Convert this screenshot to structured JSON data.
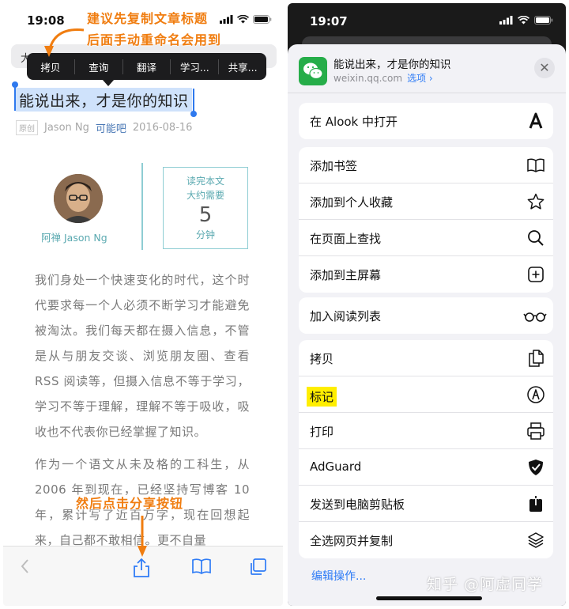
{
  "left": {
    "time": "19:08",
    "address_prefix": "大",
    "annotation_top_line1": "建议先复制文章标题",
    "annotation_top_line2": "后面手动重命名会用到",
    "annotation_bottom": "然后点击分享按钮",
    "edit_menu": [
      "拷贝",
      "查询",
      "翻译",
      "学习...",
      "共享..."
    ],
    "article": {
      "title": "能说出来，才是你的知识",
      "original_badge": "原创",
      "author_name": "Jason Ng",
      "author_link": "可能吧",
      "date": "2016-08-16",
      "author_caption": "阿禅 Jason Ng",
      "read_line1": "读完本文",
      "read_line2": "大约需要",
      "read_minutes": "5",
      "read_unit": "分钟",
      "paragraph1": "我们身处一个快速变化的时代，这个时代要求每一个人必须不断学习才能避免被淘汰。我们每天都在摄入信息，不管是从与朋友交谈、浏览朋友圈、查看 RSS 阅读等，但摄入信息不等于学习，学习不等于理解，理解不等于吸收，吸收也不代表你已经掌握了知识。",
      "paragraph2": "作为一个语文从未及格的工科生，从 2006 年到现在，已经坚持写博客 10 年，累计写了近百万字，现在回想起来，自己都不敢相信。更不自量"
    },
    "toolbar_icons": [
      "chevron-left-icon",
      "share-icon",
      "book-icon",
      "tabs-icon"
    ]
  },
  "right": {
    "time": "19:07",
    "sheet_title": "能说出来，才是你的知识",
    "sheet_domain": "weixin.qq.com",
    "sheet_options": "选项 ›",
    "close_symbol": "✕",
    "groups": [
      [
        {
          "label": "在 Alook 中打开",
          "icon": "alook-icon"
        }
      ],
      [
        {
          "label": "添加书签",
          "icon": "book-icon"
        },
        {
          "label": "添加到个人收藏",
          "icon": "star-icon"
        },
        {
          "label": "在页面上查找",
          "icon": "search-icon"
        },
        {
          "label": "添加到主屏幕",
          "icon": "plus-square-icon"
        }
      ],
      [
        {
          "label": "加入阅读列表",
          "icon": "glasses-icon"
        }
      ],
      [
        {
          "label": "拷贝",
          "icon": "copy-icon"
        },
        {
          "label": "标记",
          "icon": "markup-icon"
        },
        {
          "label": "打印",
          "icon": "printer-icon"
        },
        {
          "label": "AdGuard",
          "icon": "adguard-icon"
        },
        {
          "label": "发送到电脑剪贴板",
          "icon": "share-box-icon"
        },
        {
          "label": "全选网页并复制",
          "icon": "layers-icon"
        }
      ]
    ],
    "edit_actions": "编辑操作..."
  },
  "watermark": "知乎 @阿虚同学",
  "colors": {
    "annotation": "#f07d10",
    "highlight": "#ffee00",
    "ios_blue": "#2f7cf6",
    "wechat_green": "#26ad49"
  }
}
